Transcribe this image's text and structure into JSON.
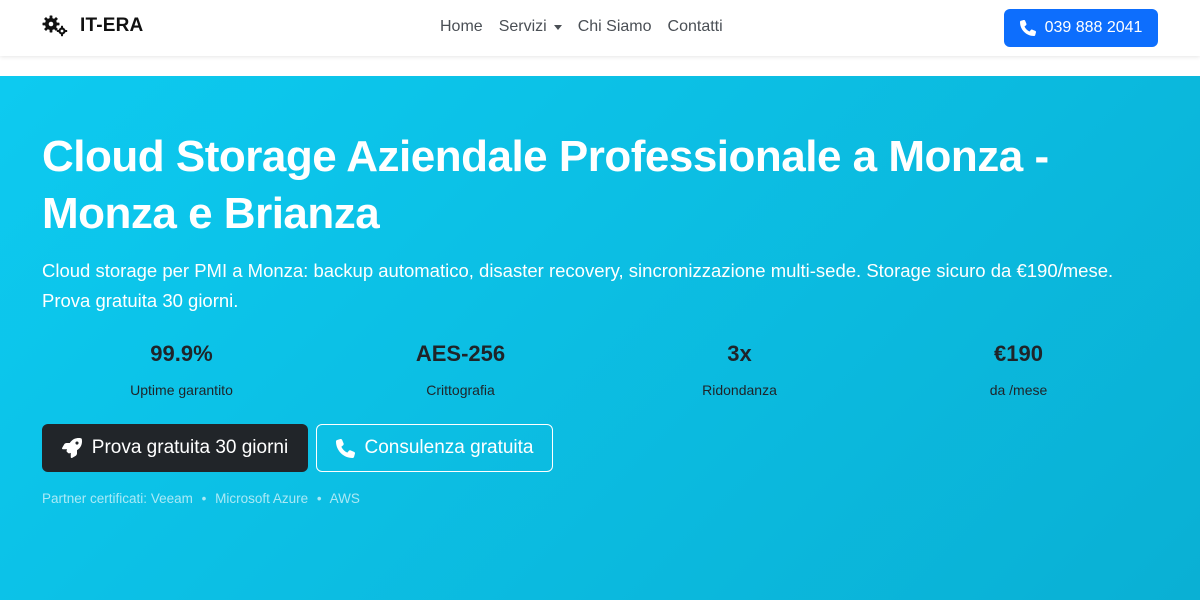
{
  "navbar": {
    "brand": {
      "icon": "gears-icon",
      "name": "IT-ERA"
    },
    "links": [
      {
        "label": "Home",
        "dropdown": false
      },
      {
        "label": "Servizi",
        "dropdown": true
      },
      {
        "label": "Chi Siamo",
        "dropdown": false
      },
      {
        "label": "Contatti",
        "dropdown": false
      }
    ],
    "phone_button": {
      "icon": "phone-icon",
      "label": "039 888 2041",
      "color": "#0d6efd"
    }
  },
  "hero": {
    "background_colors": [
      "#0dcaf0",
      "#0ab0d4"
    ],
    "title": "Cloud Storage Aziendale Professionale a Monza - Monza e Brianza",
    "description": "Cloud storage per PMI a Monza: backup automatico, disaster recovery, sincronizzazione multi-sede. Storage sicuro da €190/mese. Prova gratuita 30 giorni.",
    "stats": [
      {
        "value": "99.9%",
        "label": "Uptime garantito"
      },
      {
        "value": "AES-256",
        "label": "Crittografia"
      },
      {
        "value": "3x",
        "label": "Ridondanza"
      },
      {
        "value": "€190",
        "label": "da /mese"
      }
    ],
    "cta_primary": {
      "icon": "rocket-icon",
      "label": "Prova gratuita 30 giorni",
      "color": "#212529"
    },
    "cta_secondary": {
      "icon": "phone-icon",
      "label": "Consulenza gratuita"
    },
    "partners": {
      "prefix": "Partner certificati:",
      "items": [
        "Veeam",
        "Microsoft Azure",
        "AWS"
      ],
      "separator": "•"
    }
  }
}
